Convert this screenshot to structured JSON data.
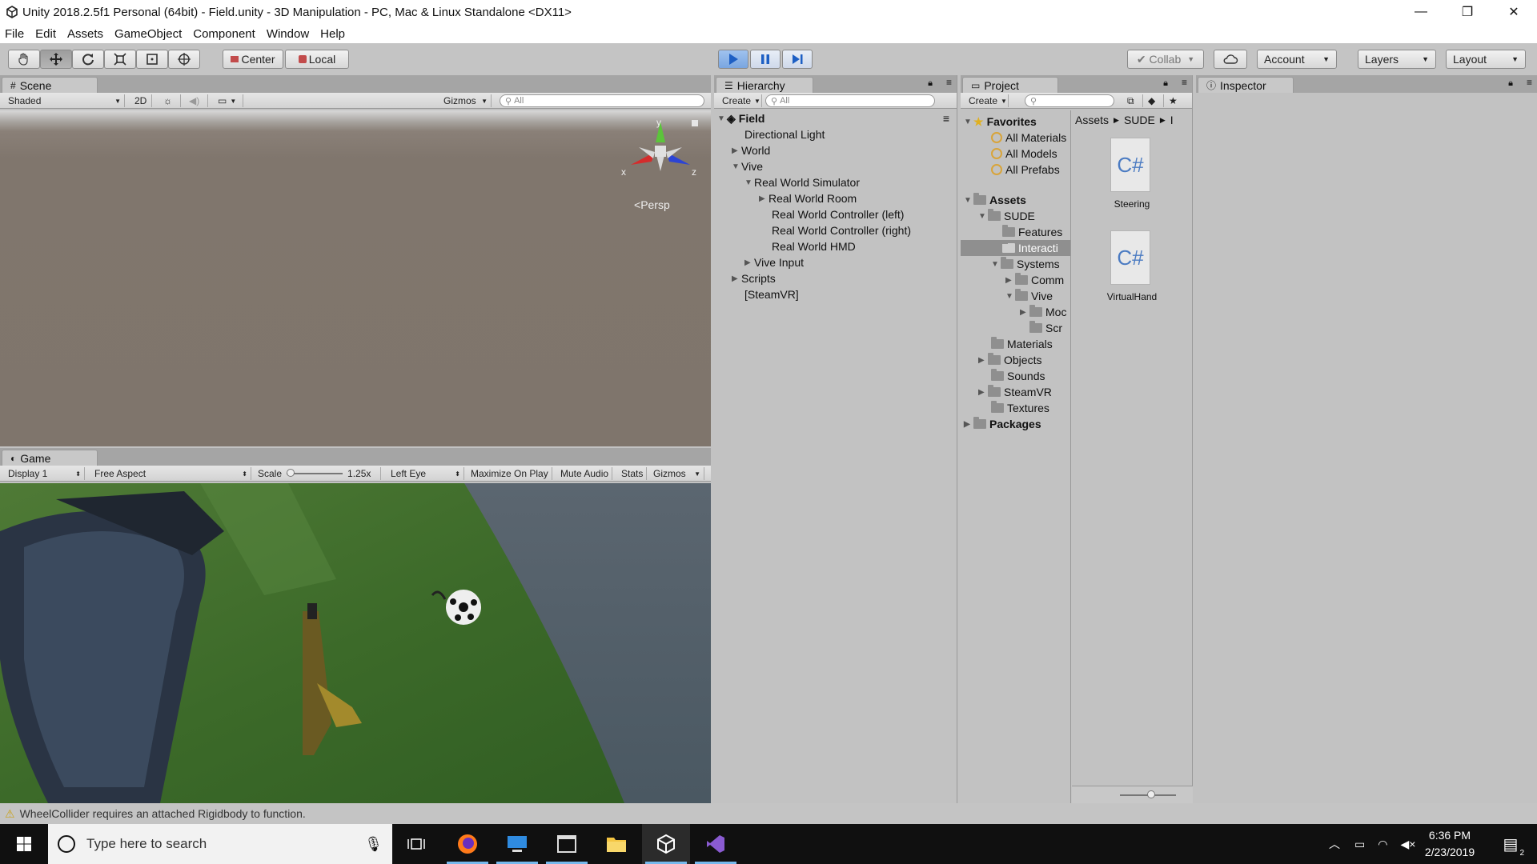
{
  "window": {
    "title": "Unity 2018.2.5f1 Personal (64bit) - Field.unity - 3D Manipulation - PC, Mac & Linux Standalone <DX11>",
    "minimize": "—",
    "restore": "❐",
    "close": "✕"
  },
  "menu": [
    "File",
    "Edit",
    "Assets",
    "GameObject",
    "Component",
    "Window",
    "Help"
  ],
  "toolbar": {
    "pivot_label": "Center",
    "space_label": "Local",
    "collab_label": "Collab",
    "account_label": "Account",
    "layers_label": "Layers",
    "layout_label": "Layout"
  },
  "scene": {
    "tab_label": "Scene",
    "shading_mode": "Shaded",
    "mode_2d": "2D",
    "gizmos_label": "Gizmos",
    "search_placeholder": "All",
    "persp_label": "Persp",
    "axis_x": "x",
    "axis_y": "y",
    "axis_z": "z"
  },
  "game": {
    "tab_label": "Game",
    "display": "Display 1",
    "aspect": "Free Aspect",
    "scale_label": "Scale",
    "scale_value": "1.25x",
    "eye": "Left Eye",
    "maximize_label": "Maximize On Play",
    "mute_label": "Mute Audio",
    "stats_label": "Stats",
    "gizmos_label": "Gizmos"
  },
  "hierarchy": {
    "tab_label": "Hierarchy",
    "create_label": "Create",
    "search_placeholder": "All",
    "scene_name": "Field",
    "items": [
      {
        "label": "Directional Light"
      },
      {
        "label": "World"
      },
      {
        "label": "Vive"
      },
      {
        "label": "Real World Simulator"
      },
      {
        "label": "Real World Room"
      },
      {
        "label": "Real World Controller (left)"
      },
      {
        "label": "Real World Controller (right)"
      },
      {
        "label": "Real World HMD"
      },
      {
        "label": "Vive Input"
      },
      {
        "label": "Scripts"
      },
      {
        "label": "[SteamVR]"
      }
    ]
  },
  "project": {
    "tab_label": "Project",
    "create_label": "Create",
    "favorites_label": "Favorites",
    "favorites": [
      "All Materials",
      "All Models",
      "All Prefabs"
    ],
    "assets_label": "Assets",
    "tree": [
      "SUDE",
      "Features",
      "Interacti",
      "Systems",
      "Comm",
      "Vive",
      "Moc",
      "Scr",
      "Materials",
      "Objects",
      "Sounds",
      "SteamVR",
      "Textures"
    ],
    "packages_label": "Packages",
    "breadcrumb": [
      "Assets",
      "SUDE",
      "I"
    ],
    "files": [
      {
        "icon": "C#",
        "name": "Steering"
      },
      {
        "icon": "C#",
        "name": "VirtualHand"
      }
    ]
  },
  "inspector": {
    "tab_label": "Inspector"
  },
  "status": {
    "message": "WheelCollider requires an attached Rigidbody to function."
  },
  "taskbar": {
    "search_placeholder": "Type here to search",
    "time": "6:36 PM",
    "date": "2/23/2019",
    "notification_count": "2"
  },
  "colors": {
    "play_active": "#7aa6e0",
    "unity_bg": "#c2c2c2",
    "grass": "#3f6b2c",
    "water": "#4a5660"
  }
}
